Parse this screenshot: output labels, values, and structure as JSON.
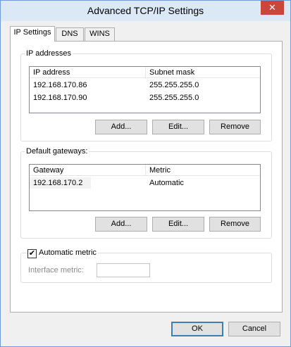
{
  "window": {
    "title": "Advanced TCP/IP Settings",
    "close_glyph": "✕"
  },
  "tabs": [
    {
      "label": "IP Settings"
    },
    {
      "label": "DNS"
    },
    {
      "label": "WINS"
    }
  ],
  "ip_addresses": {
    "group_label": "IP addresses",
    "columns": [
      "IP address",
      "Subnet mask"
    ],
    "rows": [
      {
        "ip": "192.168.170.86",
        "mask": "255.255.255.0"
      },
      {
        "ip": "192.168.170.90",
        "mask": "255.255.255.0"
      }
    ],
    "buttons": {
      "add": "Add...",
      "edit": "Edit...",
      "remove": "Remove"
    }
  },
  "gateways": {
    "group_label": "Default gateways:",
    "columns": [
      "Gateway",
      "Metric"
    ],
    "rows": [
      {
        "gateway": "192.168.170.2",
        "metric": "Automatic"
      }
    ],
    "buttons": {
      "add": "Add...",
      "edit": "Edit...",
      "remove": "Remove"
    }
  },
  "metric": {
    "checkbox_label": "Automatic metric",
    "checked": true,
    "check_glyph": "✔",
    "interface_metric_label": "Interface metric:",
    "interface_metric_value": ""
  },
  "footer": {
    "ok": "OK",
    "cancel": "Cancel"
  }
}
